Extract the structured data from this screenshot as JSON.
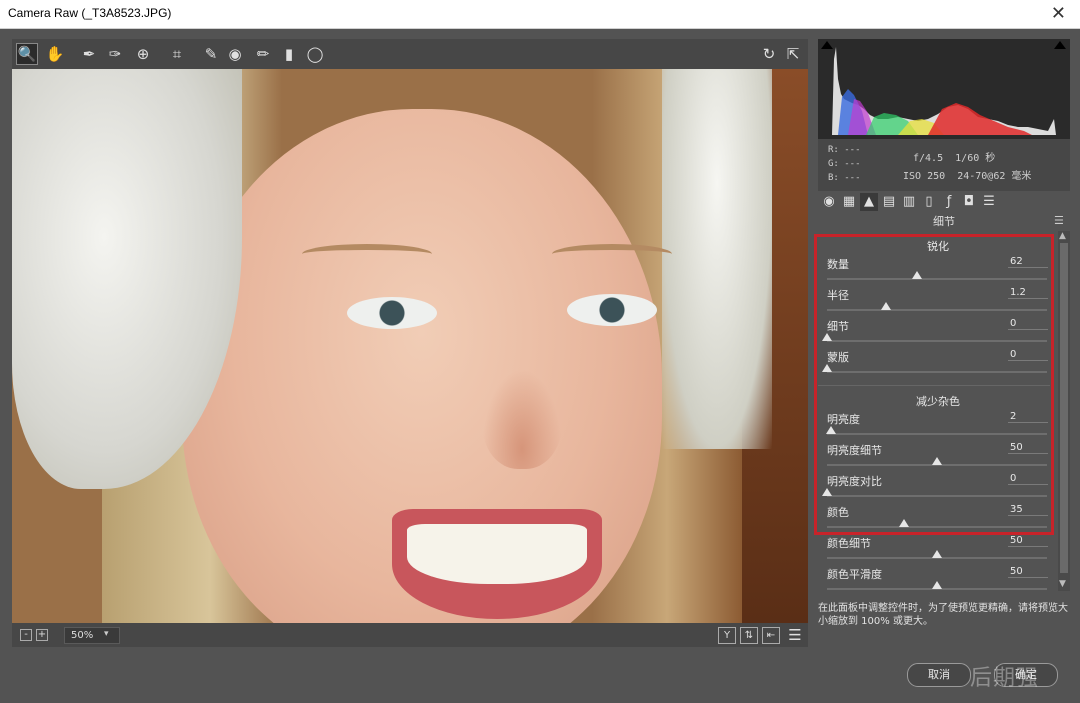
{
  "window": {
    "title": "Camera Raw (_T3A8523.JPG)",
    "close_icon": "close-icon"
  },
  "toolbar": {
    "tools": [
      "zoom-icon",
      "hand-icon",
      "white-balance-icon",
      "color-sampler-icon",
      "targeted-adjustment-icon",
      "crop-icon",
      "spot-removal-icon",
      "red-eye-icon",
      "brush-icon",
      "graduated-filter-icon",
      "radial-filter-icon"
    ],
    "right_tools": [
      "rotate-icon",
      "fullscreen-icon"
    ]
  },
  "metadata": {
    "r_label": "R:",
    "r_value": "---",
    "g_label": "G:",
    "g_value": "---",
    "b_label": "B:",
    "b_value": "---",
    "aperture": "f/4.5",
    "shutter": "1/60 秒",
    "iso": "ISO 250",
    "lens": "24-70@62 毫米"
  },
  "panel": {
    "title": "细节",
    "sharpening": {
      "title": "锐化",
      "sliders": [
        {
          "label": "数量",
          "value": "62",
          "fraction": 0.41
        },
        {
          "label": "半径",
          "value": "1.2",
          "fraction": 0.27
        },
        {
          "label": "细节",
          "value": "0",
          "fraction": 0.0
        },
        {
          "label": "蒙版",
          "value": "0",
          "fraction": 0.0
        }
      ]
    },
    "noise": {
      "title": "减少杂色",
      "sliders": [
        {
          "label": "明亮度",
          "value": "2",
          "fraction": 0.02
        },
        {
          "label": "明亮度细节",
          "value": "50",
          "fraction": 0.5
        },
        {
          "label": "明亮度对比",
          "value": "0",
          "fraction": 0.0
        },
        {
          "label": "颜色",
          "value": "35",
          "fraction": 0.35
        },
        {
          "label": "颜色细节",
          "value": "50",
          "fraction": 0.5
        },
        {
          "label": "颜色平滑度",
          "value": "50",
          "fraction": 0.5
        }
      ]
    },
    "hint": "在此面板中调整控件时，为了使预览更精确，请将预览大小缩放到 100% 或更大。"
  },
  "bottom": {
    "zoom": "50%",
    "zoom_minus": "-",
    "zoom_plus": "+"
  },
  "buttons": {
    "cancel": "取消",
    "ok": "确定"
  },
  "watermark": "后期强",
  "colors": {
    "highlight": "#c8232a",
    "panel_bg": "#535353"
  }
}
